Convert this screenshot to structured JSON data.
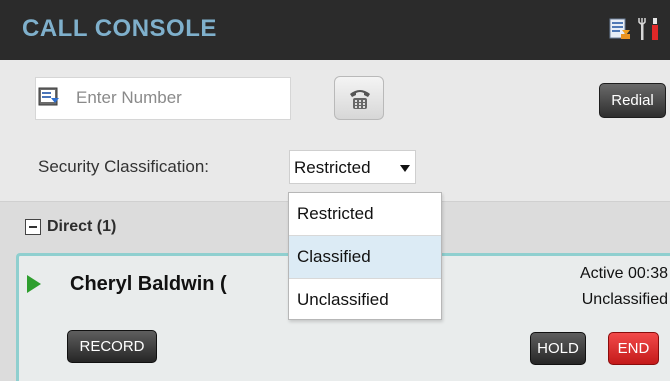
{
  "header": {
    "title": "CALL CONSOLE",
    "icons": [
      "form-icon",
      "settings-icon"
    ]
  },
  "dial": {
    "placeholder": "Enter Number",
    "book_icon": "phonebook-icon",
    "dial_icon": "phone-dialpad-icon",
    "redial_label": "Redial"
  },
  "security": {
    "label": "Security Classification:",
    "selected": "Restricted",
    "options": [
      "Restricted",
      "Classified",
      "Unclassified"
    ],
    "highlighted": "Classified"
  },
  "section": {
    "label": "Direct (1)"
  },
  "call": {
    "caller": "Cheryl Baldwin (",
    "status": "Active 00:38",
    "classification": "Unclassified",
    "record_label": "RECORD",
    "hold_label": "HOLD",
    "end_label": "END"
  },
  "colors": {
    "header_bg": "#2b2b2b",
    "title": "#7fb0cc",
    "call_border": "#8fcfcf",
    "end_button": "#d92c2c",
    "play_green": "#2e9e2e",
    "highlight": "#dcebf5"
  }
}
